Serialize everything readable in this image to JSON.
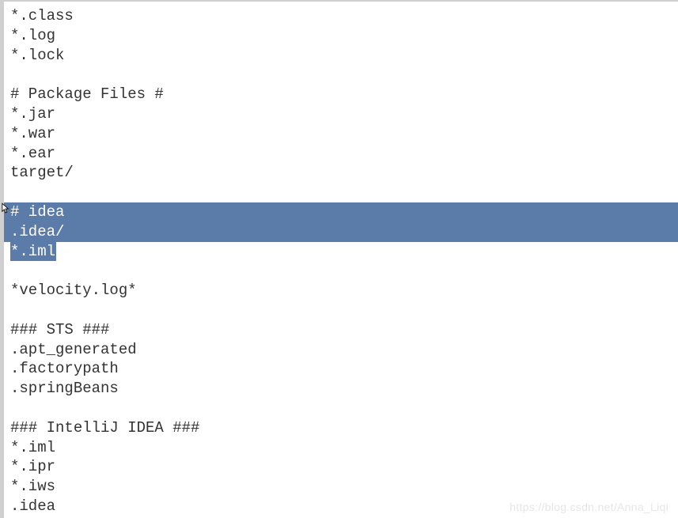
{
  "editor": {
    "lines": [
      {
        "text": "*.class",
        "selected": false
      },
      {
        "text": "*.log",
        "selected": false
      },
      {
        "text": "*.lock",
        "selected": false
      },
      {
        "text": "",
        "selected": false
      },
      {
        "text": "# Package Files #",
        "selected": false
      },
      {
        "text": "*.jar",
        "selected": false
      },
      {
        "text": "*.war",
        "selected": false
      },
      {
        "text": "*.ear",
        "selected": false
      },
      {
        "text": "target/",
        "selected": false
      },
      {
        "text": "",
        "selected": false
      },
      {
        "text": "# idea",
        "selected": true
      },
      {
        "text": ".idea/",
        "selected": true
      },
      {
        "text": "*.iml",
        "selected": "partial"
      },
      {
        "text": "",
        "selected": false
      },
      {
        "text": "*velocity.log*",
        "selected": false
      },
      {
        "text": "",
        "selected": false
      },
      {
        "text": "### STS ###",
        "selected": false
      },
      {
        "text": ".apt_generated",
        "selected": false
      },
      {
        "text": ".factorypath",
        "selected": false
      },
      {
        "text": ".springBeans",
        "selected": false
      },
      {
        "text": "",
        "selected": false
      },
      {
        "text": "### IntelliJ IDEA ###",
        "selected": false
      },
      {
        "text": "*.iml",
        "selected": false
      },
      {
        "text": "*.ipr",
        "selected": false
      },
      {
        "text": "*.iws",
        "selected": false
      },
      {
        "text": ".idea",
        "selected": false
      }
    ]
  },
  "watermark": "https://blog.csdn.net/Anna_Liqi",
  "colors": {
    "selection_bg": "#5b7ba8",
    "selection_fg": "#ffffff",
    "text_fg": "#333333"
  }
}
